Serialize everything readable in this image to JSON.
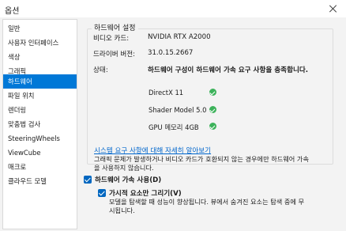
{
  "window": {
    "title": "옵션"
  },
  "sidebar": {
    "items": [
      {
        "label": "일반",
        "selected": false
      },
      {
        "label": "사용자 인터페이스",
        "selected": false
      },
      {
        "label": "색상",
        "selected": false
      },
      {
        "label": "그래픽",
        "selected": false
      },
      {
        "label": "하드웨어",
        "selected": true
      },
      {
        "label": "파일 위치",
        "selected": false
      },
      {
        "label": "렌더링",
        "selected": false
      },
      {
        "label": "맞춤법 검사",
        "selected": false
      },
      {
        "label": "SteeringWheels",
        "selected": false
      },
      {
        "label": "ViewCube",
        "selected": false
      },
      {
        "label": "매크로",
        "selected": false
      },
      {
        "label": "클라우드 모델",
        "selected": false
      }
    ]
  },
  "hardware": {
    "group_title": "하드웨어 설정",
    "video_card_label": "비디오 카드:",
    "video_card_value": "NVIDIA RTX A2000",
    "driver_label": "드라이버 버전:",
    "driver_value": "31.0.15.2667",
    "status_label": "상태:",
    "status_value": "하드웨어 구성이 하드웨어 가속 요구 사항을 충족합니다.",
    "checks": [
      {
        "label": "DirectX 11",
        "icon": "check-circle-icon",
        "color": "#3cb25a"
      },
      {
        "label": "Shader Model 5.0",
        "icon": "check-circle-icon",
        "color": "#3cb25a"
      },
      {
        "label": "GPU 메모리 4GB",
        "icon": "check-circle-icon",
        "color": "#3cb25a"
      }
    ]
  },
  "info": {
    "link_text": "시스템 요구 사항에 대해 자세히 알아보기",
    "note_line1": "그래픽 문제가 발생하거나 비디오 카드가 호환되지 않는 경우에만 하드웨어 가속",
    "note_line2": "을 사용하지 않습니다."
  },
  "options": {
    "hw_accel_label": "하드웨어 가속 사용(D)",
    "hw_accel_checked": true,
    "virtual_tricks_label": "가시적 요소만 그리기(V)",
    "virtual_tricks_checked": true,
    "virtual_note_line1": "모델을 탐색할 때 성능이 향상됩니다. 뷰에서 숨겨진 요소는 탐색 중에 무",
    "virtual_note_line2": "시됩니다."
  },
  "colors": {
    "accent": "#0078d7",
    "checkbox": "#0067c0",
    "ok": "#3cb25a",
    "link": "#0066cc"
  }
}
